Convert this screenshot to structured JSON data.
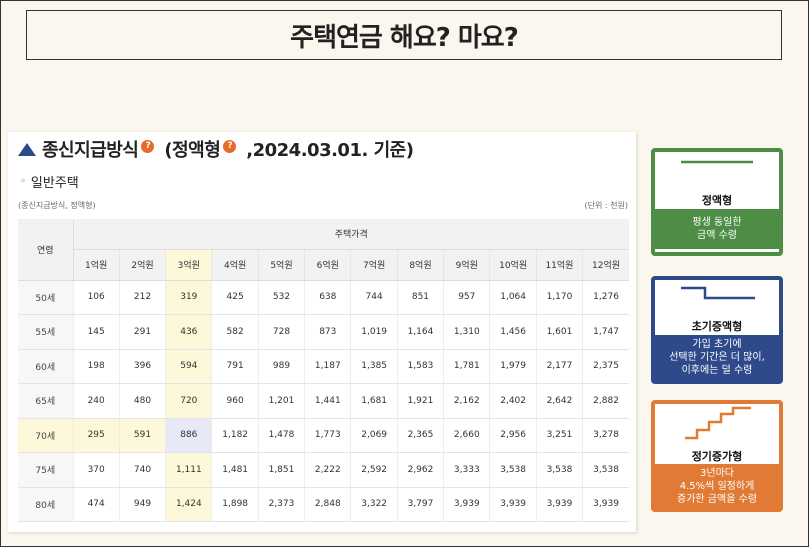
{
  "title": "주택연금 해요? 마요?",
  "panel": {
    "heading_method": "종신지급방식",
    "heading_type": "(정액형",
    "heading_date": ",2024.03.01. 기준)",
    "help_icon_glyph": "?",
    "subtitle": "일반주택",
    "note_left": "(종신지급방식, 정액형)",
    "note_right": "(단위 : 천원)"
  },
  "table": {
    "age_header": "연령",
    "group_header": "주택가격",
    "columns": [
      "1억원",
      "2억원",
      "3억원",
      "4억원",
      "5억원",
      "6억원",
      "7억원",
      "8억원",
      "9억원",
      "10억원",
      "11억원",
      "12억원"
    ],
    "rows": [
      {
        "age": "50세",
        "values": [
          "106",
          "212",
          "319",
          "425",
          "532",
          "638",
          "744",
          "851",
          "957",
          "1,064",
          "1,170",
          "1,276"
        ]
      },
      {
        "age": "55세",
        "values": [
          "145",
          "291",
          "436",
          "582",
          "728",
          "873",
          "1,019",
          "1,164",
          "1,310",
          "1,456",
          "1,601",
          "1,747"
        ]
      },
      {
        "age": "60세",
        "values": [
          "198",
          "396",
          "594",
          "791",
          "989",
          "1,187",
          "1,385",
          "1,583",
          "1,781",
          "1,979",
          "2,177",
          "2,375"
        ]
      },
      {
        "age": "65세",
        "values": [
          "240",
          "480",
          "720",
          "960",
          "1,201",
          "1,441",
          "1,681",
          "1,921",
          "2,162",
          "2,402",
          "2,642",
          "2,882"
        ]
      },
      {
        "age": "70세",
        "values": [
          "295",
          "591",
          "886",
          "1,182",
          "1,478",
          "1,773",
          "2,069",
          "2,365",
          "2,660",
          "2,956",
          "3,251",
          "3,278"
        ]
      },
      {
        "age": "75세",
        "values": [
          "370",
          "740",
          "1,111",
          "1,481",
          "1,851",
          "2,222",
          "2,592",
          "2,962",
          "3,333",
          "3,538",
          "3,538",
          "3,538"
        ]
      },
      {
        "age": "80세",
        "values": [
          "474",
          "949",
          "1,424",
          "1,898",
          "2,373",
          "2,848",
          "3,322",
          "3,797",
          "3,939",
          "3,939",
          "3,939",
          "3,939"
        ]
      }
    ],
    "highlight_column": "3억원",
    "highlight_row": "70세"
  },
  "cards": [
    {
      "name": "정액형",
      "desc1": "평생 동일한",
      "desc2": "금액 수령",
      "desc3": "",
      "color": "#4d8d45"
    },
    {
      "name": "초기증액형",
      "desc1": "가입 초기에",
      "desc2": "선택한 기간은 더 많이,",
      "desc3": "이후에는 덜 수령",
      "color": "#2f4a8a"
    },
    {
      "name": "정기증가형",
      "desc1": "3년마다",
      "desc2": "4.5%씩 일정하게",
      "desc3": "증가한 금액을 수령",
      "color": "#e07a34"
    }
  ]
}
